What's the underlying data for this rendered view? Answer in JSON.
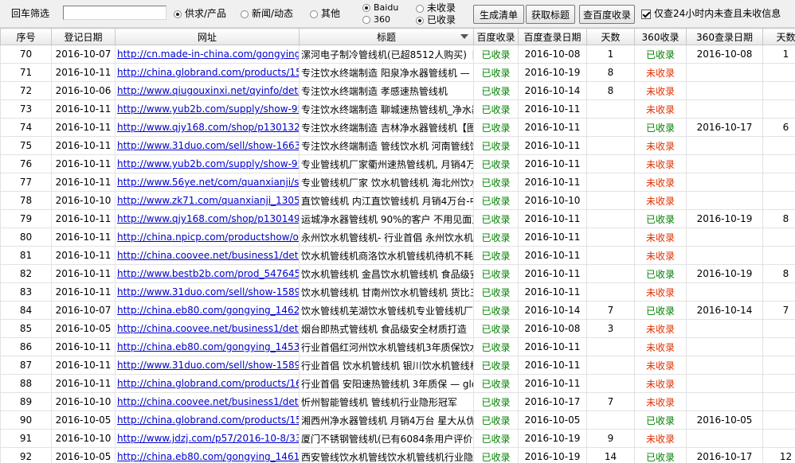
{
  "toolbar": {
    "filter_label": "回车筛选",
    "filter_value": "",
    "type_options": [
      {
        "label": "供求/产品",
        "selected": true
      },
      {
        "label": "新闻/动态",
        "selected": false
      },
      {
        "label": "其他",
        "selected": false
      }
    ],
    "engine_options": [
      {
        "label": "Baidu",
        "selected": true
      },
      {
        "label": "360",
        "selected": false
      }
    ],
    "status_options": [
      {
        "label": "未收录",
        "selected": false
      },
      {
        "label": "已收录",
        "selected": true
      }
    ],
    "btn_generate": "生成清单",
    "btn_get_title": "获取标题",
    "btn_check_baidu": "查百度收录",
    "only24h_label": "仅查24小时内未查且未收信息",
    "only24h_checked": true
  },
  "columns": [
    "序号",
    "登记日期",
    "网址",
    "标题",
    "百度收录",
    "百度查录日期",
    "天数",
    "360收录",
    "360查录日期",
    "天数"
  ],
  "status_colors": {
    "ok": "#008000",
    "no": "#e03000",
    "link": "#0000cc"
  },
  "rows": [
    [
      "70",
      "2016-10-07",
      "http://cn.made-in-china.com/gongying/qua",
      "漯河电子制冷管线机(已超8512人购买)【",
      "已收录",
      "2016-10-08",
      "1",
      "已收录",
      "2016-10-08",
      "1"
    ],
    [
      "71",
      "2016-10-11",
      "http://china.globrand.com/products/15765",
      "专注饮水终端制造 阳泉净水器管线机 — g",
      "已收录",
      "2016-10-19",
      "8",
      "未收录",
      "",
      ""
    ],
    [
      "72",
      "2016-10-06",
      "http://www.qiugouxinxi.net/qyinfo/detail_qy-",
      "专注饮水终端制造 孝感速热管线机",
      "已收录",
      "2016-10-14",
      "8",
      "未收录",
      "",
      ""
    ],
    [
      "73",
      "2016-10-11",
      "http://www.yub2b.com/supply/show-95350",
      "专注饮水终端制造 聊城速热管线机_净水器",
      "已收录",
      "2016-10-11",
      "",
      "未收录",
      "",
      ""
    ],
    [
      "74",
      "2016-10-11",
      "http://www.qjy168.com/shop/p130132081",
      "专注饮水终端制造 吉林净水器管线机【图",
      "已收录",
      "2016-10-11",
      "",
      "已收录",
      "2016-10-17",
      "6"
    ],
    [
      "75",
      "2016-10-11",
      "http://www.31duo.com/sell/show-16636.ht",
      "专注饮水终端制造 管线饮水机 河南管线饮",
      "已收录",
      "2016-10-11",
      "",
      "未收录",
      "",
      ""
    ],
    [
      "76",
      "2016-10-11",
      "http://www.yub2b.com/supply/show-95364",
      "专业管线机厂家衢州速热管线机, 月销4万台",
      "已收录",
      "2016-10-11",
      "",
      "未收录",
      "",
      ""
    ],
    [
      "77",
      "2016-10-11",
      "http://www.56ye.net/com/quanxianji/sell/ite",
      "专业管线机厂家 饮水机管线机 海北州饮水",
      "已收录",
      "2016-10-11",
      "",
      "未收录",
      "",
      ""
    ],
    [
      "78",
      "2016-10-10",
      "http://www.zk71.com/quanxianji_1305/proc",
      "直饮管线机 内江直饮管线机 月销4万台-中",
      "已收录",
      "2016-10-10",
      "",
      "未收录",
      "",
      ""
    ],
    [
      "79",
      "2016-10-11",
      "http://www.qjy168.com/shop/p130149098",
      "运城净水器管线机 90%的客户 不用见面直",
      "已收录",
      "2016-10-11",
      "",
      "已收录",
      "2016-10-19",
      "8"
    ],
    [
      "80",
      "2016-10-11",
      "http://china.npicp.com/productshow/offerde",
      "永州饮水机管线机- 行业首倡 永州饮水机管",
      "已收录",
      "2016-10-11",
      "",
      "未收录",
      "",
      ""
    ],
    [
      "81",
      "2016-10-11",
      "http://china.coovee.net/business1/detail/34",
      "饮水机管线机商洛饮水机管线机待机不耗能",
      "已收录",
      "2016-10-11",
      "",
      "未收录",
      "",
      ""
    ],
    [
      "82",
      "2016-10-11",
      "http://www.bestb2b.com/prod_54764510.h",
      "饮水机管线机 金昌饮水机管线机 食品级安",
      "已收录",
      "2016-10-11",
      "",
      "已收录",
      "2016-10-19",
      "8"
    ],
    [
      "83",
      "2016-10-11",
      "http://www.31duo.com/sell/show-15891.ht",
      "饮水机管线机 甘南州饮水机管线机 货比三",
      "已收录",
      "2016-10-11",
      "",
      "未收录",
      "",
      ""
    ],
    [
      "84",
      "2016-10-07",
      "http://china.eb80.com/gongying_14627847",
      "饮水管线机芜湖饮水管线机专业管线机厂家",
      "已收录",
      "2016-10-14",
      "7",
      "已收录",
      "2016-10-14",
      "7"
    ],
    [
      "85",
      "2016-10-05",
      "http://china.coovee.net/business1/detail/34",
      "烟台即热式管线机 食品级安全材质打造",
      "已收录",
      "2016-10-08",
      "3",
      "未收录",
      "",
      ""
    ],
    [
      "86",
      "2016-10-11",
      "http://china.eb80.com/gongying_14537670",
      "行业首倡红河州饮水机管线机3年质保饮水",
      "已收录",
      "2016-10-11",
      "",
      "未收录",
      "",
      ""
    ],
    [
      "87",
      "2016-10-11",
      "http://www.31duo.com/sell/show-15890.ht",
      "行业首倡 饮水机管线机 银川饮水机管线机",
      "已收录",
      "2016-10-11",
      "",
      "未收录",
      "",
      ""
    ],
    [
      "88",
      "2016-10-11",
      "http://china.globrand.com/products/162910",
      "行业首倡 安阳速热管线机 3年质保 — glol",
      "已收录",
      "2016-10-11",
      "",
      "未收录",
      "",
      ""
    ],
    [
      "89",
      "2016-10-10",
      "http://china.coovee.net/business1/detail/34",
      "忻州智能管线机 管线机行业隐形冠军",
      "已收录",
      "2016-10-17",
      "7",
      "未收录",
      "",
      ""
    ],
    [
      "90",
      "2016-10-05",
      "http://china.globrand.com/products/15624",
      "湘西州净水器管线机 月销4万台 星大从优",
      "已收录",
      "2016-10-05",
      "",
      "已收录",
      "2016-10-05",
      ""
    ],
    [
      "91",
      "2016-10-10",
      "http://www.jdzj.com/p57/2016-10-8/336231",
      "厦门不锈钢管线机(已有6084条用户评价)",
      "已收录",
      "2016-10-19",
      "9",
      "未收录",
      "",
      ""
    ],
    [
      "92",
      "2016-10-05",
      "http://china.eb80.com/gongying_14610218",
      "西安管线饮水机管线饮水机管线机行业隐",
      "已收录",
      "2016-10-19",
      "14",
      "已收录",
      "2016-10-17",
      "12"
    ]
  ]
}
